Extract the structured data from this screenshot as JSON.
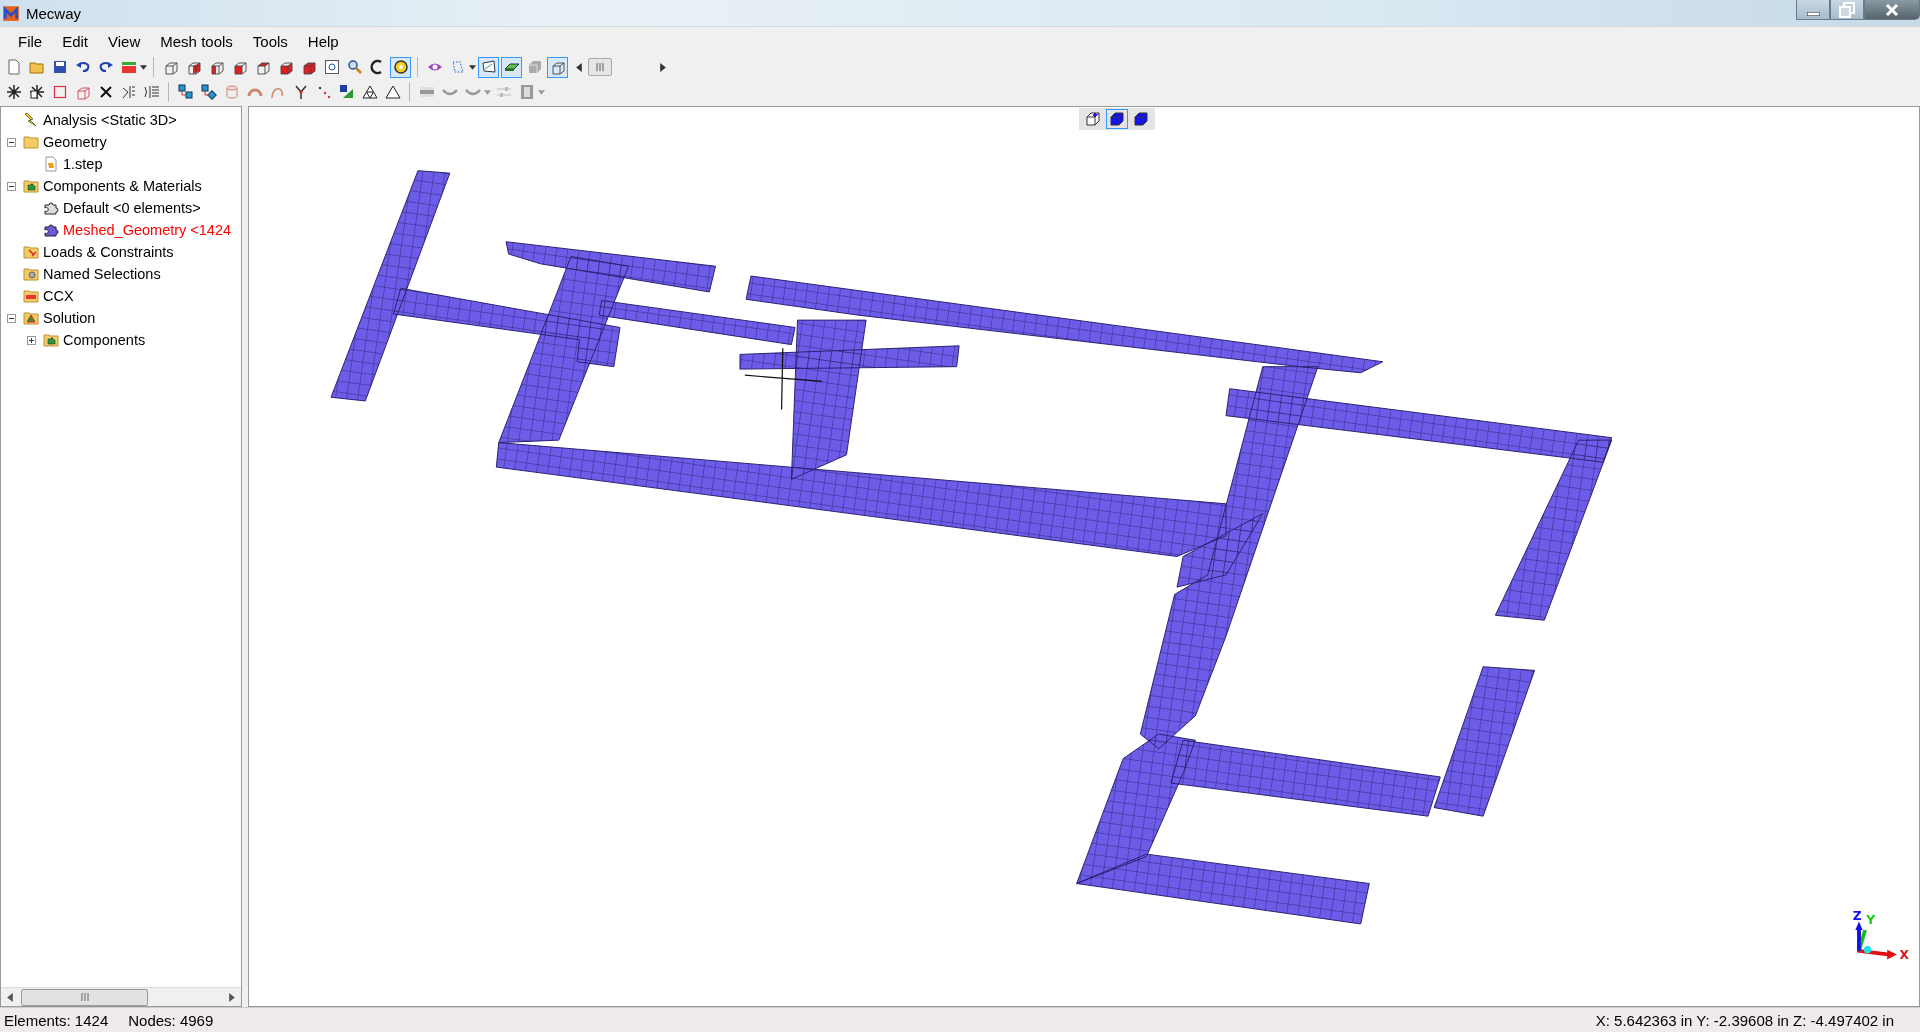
{
  "window": {
    "title": "Mecway"
  },
  "menu": [
    "File",
    "Edit",
    "View",
    "Mesh tools",
    "Tools",
    "Help"
  ],
  "toolbar_1": [
    {
      "pressed": false
    },
    {
      "pressed": false
    },
    {
      "pressed": false
    },
    {
      "pressed": false
    },
    {
      "pressed": false
    },
    {
      "pressed": false
    },
    {
      "pressed": false
    },
    {
      "pressed": false
    },
    {
      "pressed": false
    },
    {
      "pressed": false
    },
    {
      "pressed": false
    },
    {
      "pressed": false
    },
    {
      "pressed": false
    },
    {
      "pressed": false
    },
    {
      "pressed": false
    },
    {
      "pressed": false
    },
    {
      "pressed": true
    },
    {
      "pressed": false
    },
    {
      "pressed": false
    },
    {
      "pressed": true
    },
    {
      "pressed": true
    },
    {
      "pressed": false
    },
    {
      "pressed": true
    }
  ],
  "toolbar_2": [
    {
      "pressed": false
    },
    {
      "pressed": false
    },
    {
      "pressed": false
    },
    {
      "pressed": false
    },
    {
      "pressed": false
    },
    {
      "pressed": false
    },
    {
      "pressed": false
    },
    {
      "pressed": false
    },
    {
      "pressed": false
    },
    {
      "pressed": false
    },
    {
      "pressed": false
    },
    {
      "pressed": false
    },
    {
      "pressed": false
    },
    {
      "pressed": false
    },
    {
      "pressed": false
    },
    {
      "pressed": false
    },
    {
      "pressed": false
    },
    {
      "pressed": false
    },
    {
      "pressed": false
    },
    {
      "pressed": false
    },
    {
      "pressed": false
    },
    {
      "pressed": false
    }
  ],
  "tree": [
    {
      "label": "Analysis <Static 3D>",
      "active": false
    },
    {
      "label": "Geometry",
      "active": false,
      "expanded": true,
      "children": [
        {
          "label": "1.step",
          "active": false
        }
      ]
    },
    {
      "label": "Components & Materials",
      "active": false,
      "expanded": true,
      "children": [
        {
          "label": "Default <0 elements>",
          "active": false
        },
        {
          "label": "Meshed_Geometry <1424",
          "active": true
        }
      ]
    },
    {
      "label": "Loads & Constraints",
      "active": false
    },
    {
      "label": "Named Selections",
      "active": false
    },
    {
      "label": "CCX",
      "active": false
    },
    {
      "label": "Solution",
      "active": false,
      "expanded": true,
      "children": [
        {
          "label": "Components",
          "active": false,
          "expanded": false
        }
      ]
    }
  ],
  "view_buttons": [
    {
      "selected": false
    },
    {
      "selected": true
    },
    {
      "selected": false
    }
  ],
  "axes": {
    "x": "X",
    "y": "Y",
    "z": "Z"
  },
  "status_bar": {
    "elements": "Elements:  1424",
    "nodes": "Nodes: 4969",
    "coordinates": "X: 5.642363 in Y: -2.39608 in Z: -4.497402 in"
  }
}
